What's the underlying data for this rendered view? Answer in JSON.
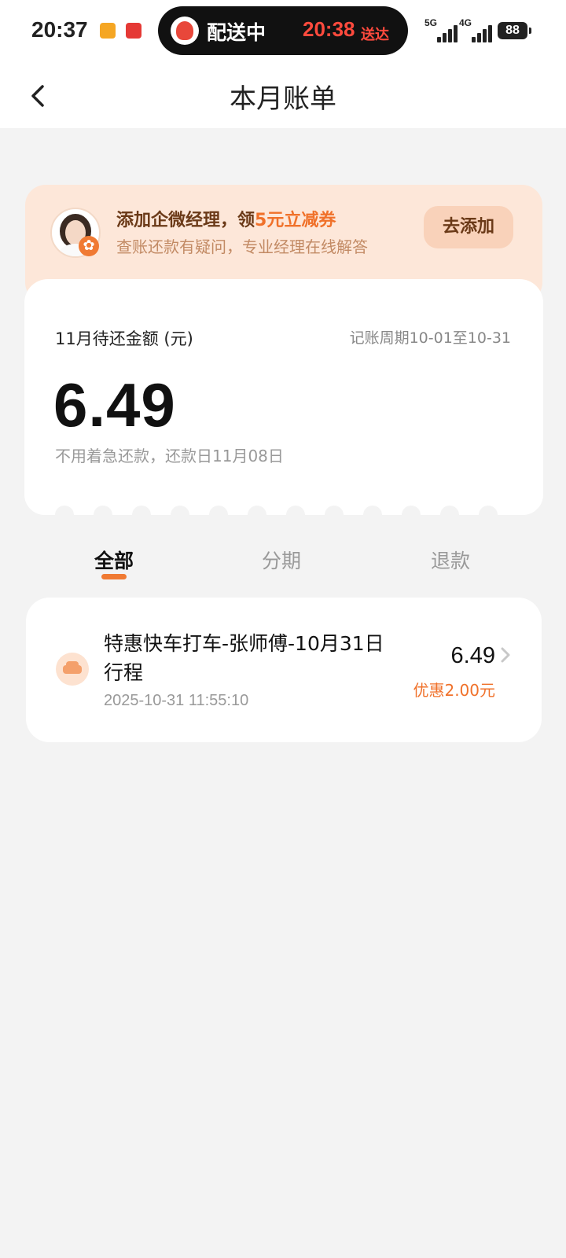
{
  "status_bar": {
    "time": "20:37",
    "island_label": "配送中",
    "island_eta": "20:38",
    "island_eta_suffix": "送达",
    "network_1": "5G",
    "network_2": "4G",
    "battery": "88"
  },
  "header": {
    "title": "本月账单"
  },
  "promo": {
    "title_prefix": "添加企微经理，领",
    "title_highlight": "5元立减券",
    "subtitle": "查账还款有疑问，专业经理在线解答",
    "button_label": "去添加"
  },
  "bill": {
    "label": "11月待还金额 (元)",
    "period": "记账周期10-01至10-31",
    "amount": "6.49",
    "note": "不用着急还款，还款日11月08日"
  },
  "tabs": [
    {
      "label": "全部",
      "active": true
    },
    {
      "label": "分期",
      "active": false
    },
    {
      "label": "退款",
      "active": false
    }
  ],
  "transactions": [
    {
      "icon": "car-icon",
      "title": "特惠快车打车-张师傅-10月31日行程",
      "time": "2025-10-31 11:55:10",
      "amount": "6.49",
      "discount": "优惠2.00元"
    }
  ],
  "colors": {
    "accent": "#f07a33",
    "promo_bg": "#fde7d9",
    "page_bg": "#f3f3f3",
    "eta_red": "#ff4a3d"
  }
}
